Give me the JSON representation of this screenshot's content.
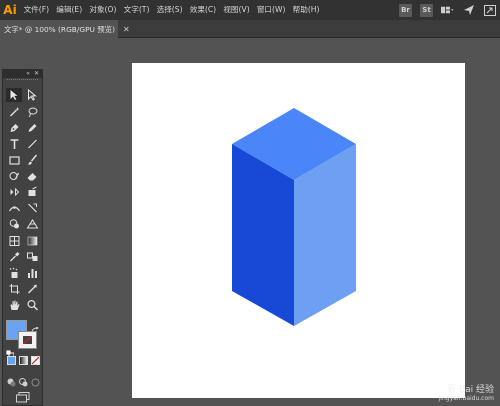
{
  "app": {
    "logo": "Ai"
  },
  "menu": {
    "items": [
      {
        "label": "文件(F)"
      },
      {
        "label": "编辑(E)"
      },
      {
        "label": "对象(O)"
      },
      {
        "label": "文字(T)"
      },
      {
        "label": "选择(S)"
      },
      {
        "label": "效果(C)"
      },
      {
        "label": "视图(V)"
      },
      {
        "label": "窗口(W)"
      },
      {
        "label": "帮助(H)"
      }
    ],
    "right_icons": [
      "bridge-icon",
      "stock-icon",
      "workspace-switcher-icon",
      "send-icon",
      "arrange-documents-icon"
    ],
    "bridge_label": "Br",
    "stock_label": "St"
  },
  "document": {
    "tab_title": "文字* @ 100% (RGB/GPU 预览)",
    "close_glyph": "✕"
  },
  "toolbar": {
    "collapse_glyph": "«",
    "close_glyph": "✕"
  },
  "colors": {
    "fill_swatch": "#6aa3f2",
    "cube_top": "#4a86f7",
    "cube_left": "#1749d6",
    "cube_right": "#6ea0f1"
  },
  "watermark": {
    "text": "百 Bai 经验",
    "sub": "jingyan.baidu.com"
  }
}
